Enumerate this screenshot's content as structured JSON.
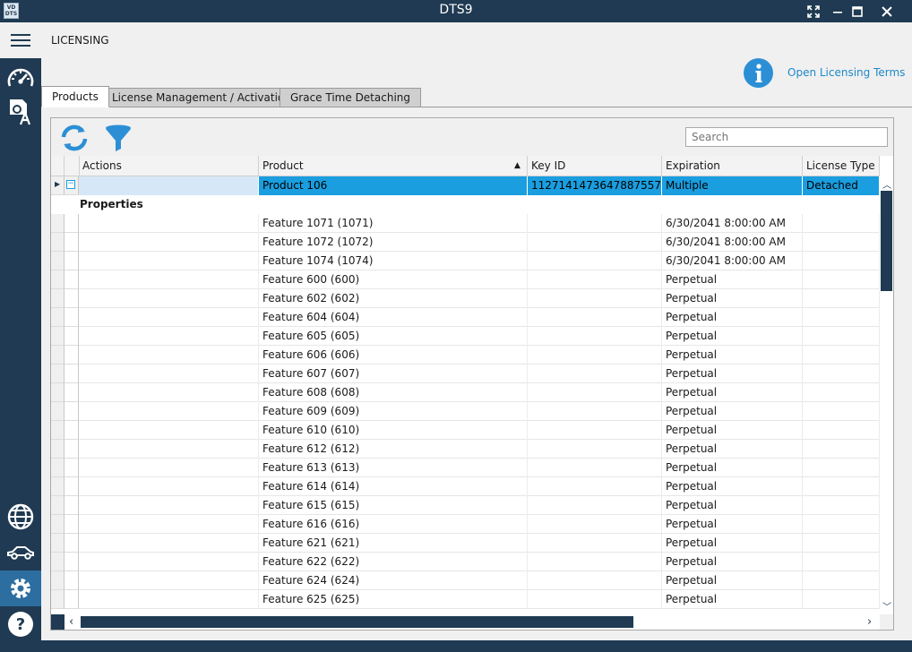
{
  "window": {
    "title": "DTS9",
    "logo_text": "VD\nDTS"
  },
  "header": {
    "section_title": "LICENSING",
    "licensing_link": "Open Licensing Terms"
  },
  "sidebar": {
    "items": [
      {
        "name": "menu-icon"
      },
      {
        "name": "dashboard-gauge-icon"
      },
      {
        "name": "translate-doc-icon"
      },
      {
        "name": "globe-icon"
      },
      {
        "name": "car-icon"
      },
      {
        "name": "settings-gear-icon",
        "active": true
      },
      {
        "name": "help-icon"
      }
    ]
  },
  "tabs": [
    {
      "label": "Products",
      "active": true
    },
    {
      "label": "License Management / Activation",
      "active": false
    },
    {
      "label": "Grace Time Detaching",
      "active": false
    }
  ],
  "toolbar": {
    "refresh": "refresh-icon",
    "filter": "filter-icon",
    "search_placeholder": "Search"
  },
  "grid": {
    "columns": [
      "Actions",
      "Product",
      "Key ID",
      "Expiration",
      "License Type"
    ],
    "sorted_column": "Product",
    "selected_row": {
      "actions": "",
      "product": "Product 106",
      "key_id": "1127141473647887557",
      "expiration": "Multiple",
      "license_type": "Detached"
    },
    "group_label": "Properties",
    "features": [
      {
        "product": "Feature 1071 (1071)",
        "expiration": "6/30/2041 8:00:00 AM"
      },
      {
        "product": "Feature 1072 (1072)",
        "expiration": "6/30/2041 8:00:00 AM"
      },
      {
        "product": "Feature 1074 (1074)",
        "expiration": "6/30/2041 8:00:00 AM"
      },
      {
        "product": "Feature 600 (600)",
        "expiration": "Perpetual"
      },
      {
        "product": "Feature 602 (602)",
        "expiration": "Perpetual"
      },
      {
        "product": "Feature 604 (604)",
        "expiration": "Perpetual"
      },
      {
        "product": "Feature 605 (605)",
        "expiration": "Perpetual"
      },
      {
        "product": "Feature 606 (606)",
        "expiration": "Perpetual"
      },
      {
        "product": "Feature 607 (607)",
        "expiration": "Perpetual"
      },
      {
        "product": "Feature 608 (608)",
        "expiration": "Perpetual"
      },
      {
        "product": "Feature 609 (609)",
        "expiration": "Perpetual"
      },
      {
        "product": "Feature 610 (610)",
        "expiration": "Perpetual"
      },
      {
        "product": "Feature 612 (612)",
        "expiration": "Perpetual"
      },
      {
        "product": "Feature 613 (613)",
        "expiration": "Perpetual"
      },
      {
        "product": "Feature 614 (614)",
        "expiration": "Perpetual"
      },
      {
        "product": "Feature 615 (615)",
        "expiration": "Perpetual"
      },
      {
        "product": "Feature 616 (616)",
        "expiration": "Perpetual"
      },
      {
        "product": "Feature 621 (621)",
        "expiration": "Perpetual"
      },
      {
        "product": "Feature 622 (622)",
        "expiration": "Perpetual"
      },
      {
        "product": "Feature 624 (624)",
        "expiration": "Perpetual"
      },
      {
        "product": "Feature 625 (625)",
        "expiration": "Perpetual"
      }
    ]
  },
  "colors": {
    "chrome": "#1f3a52",
    "selection": "#1a9ee0",
    "link": "#1e88c8",
    "active_sidebar": "#2d6ea0"
  }
}
